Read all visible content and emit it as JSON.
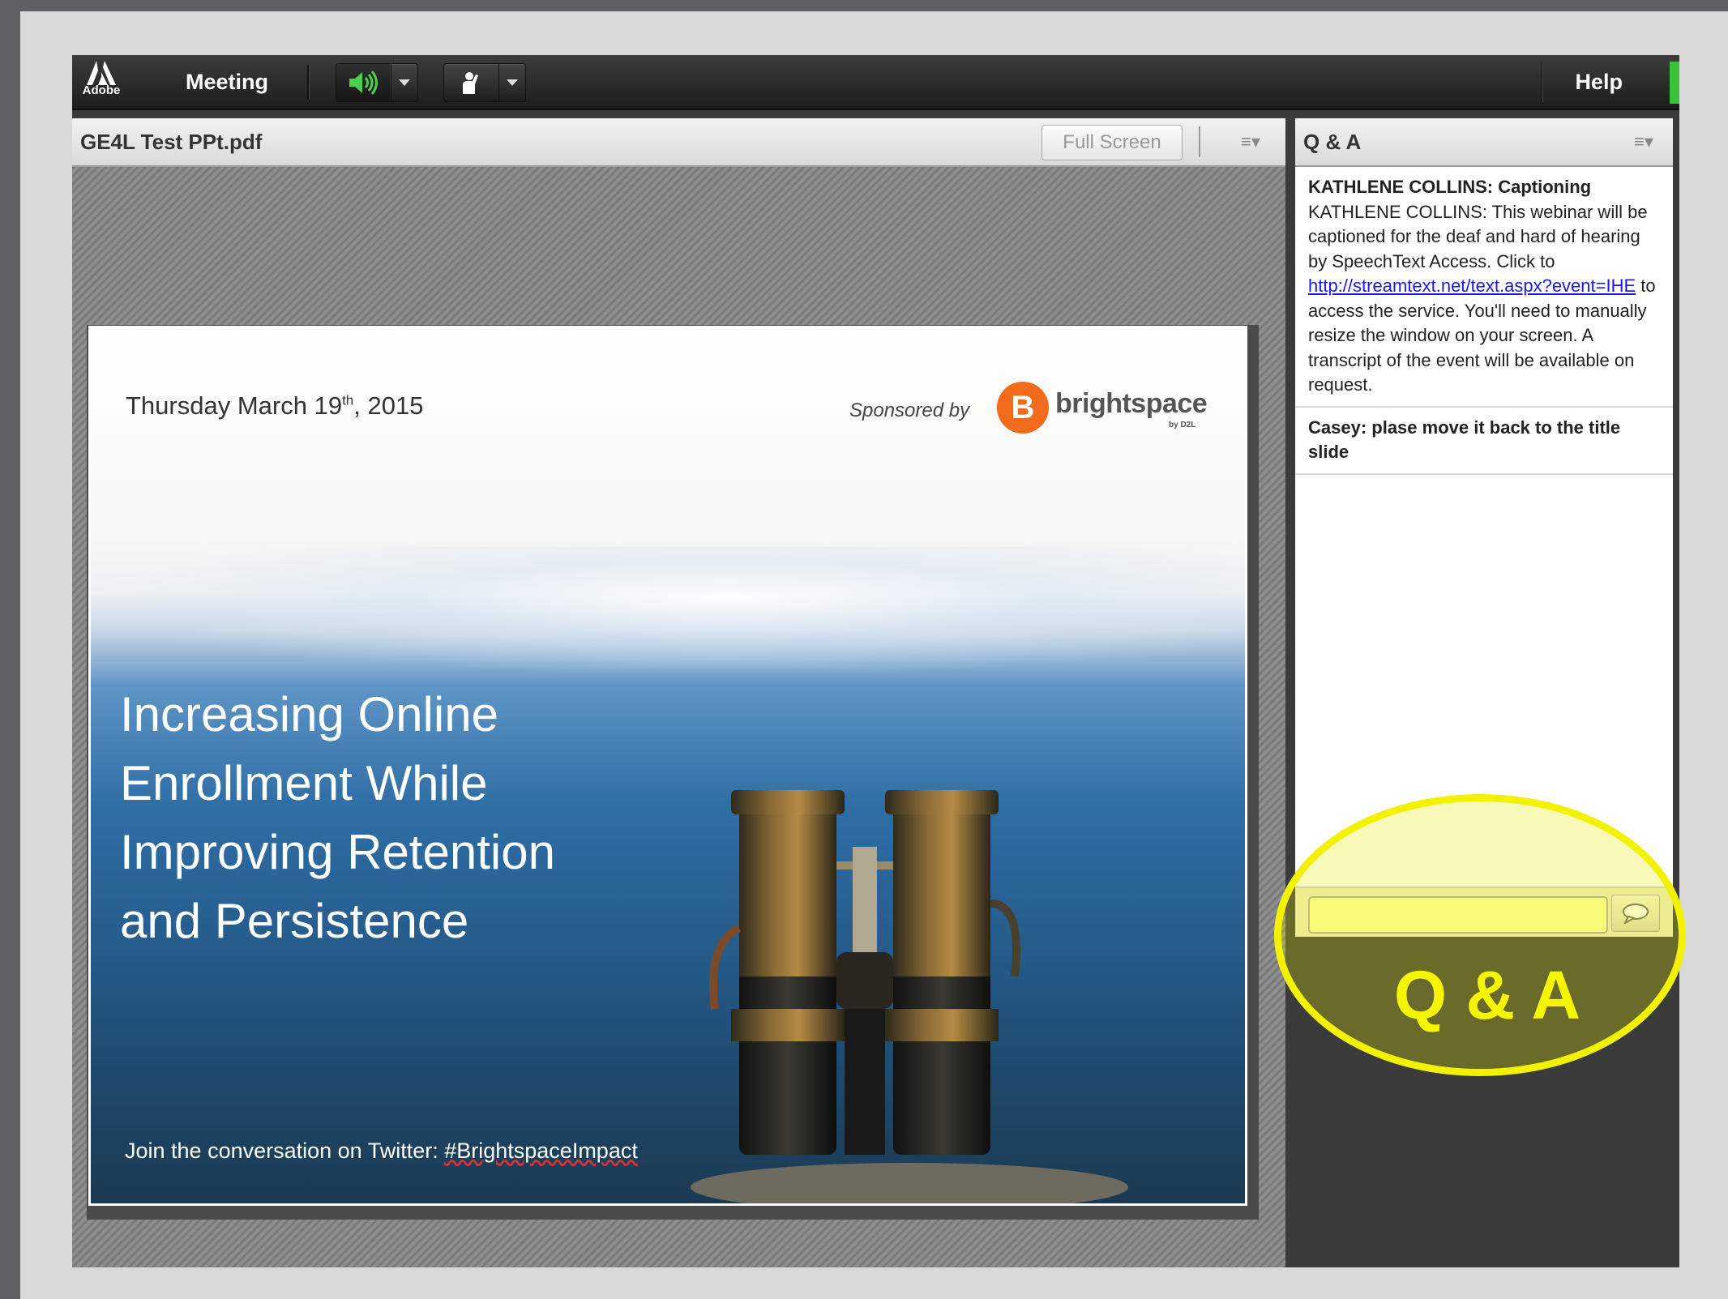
{
  "menubar": {
    "logo_text": "Adobe",
    "meeting_label": "Meeting",
    "audio_icon": "speaker-icon",
    "raise_hand_icon": "raise-hand-icon",
    "help_label": "Help"
  },
  "share_pod": {
    "title": "GE4L Test PPt.pdf",
    "fullscreen_label": "Full Screen",
    "menu_icon": "pod-options-icon"
  },
  "slide": {
    "date_main": "Thursday March 19",
    "date_sup": "th",
    "date_year": ", 2015",
    "sponsored_by": "Sponsored by",
    "brand_initial": "B",
    "brand_name": "brightspace",
    "brand_sub": "by D2L",
    "headline_lines": [
      "Increasing Online",
      "Enrollment While",
      "Improving Retention",
      "and Persistence"
    ],
    "twitter_prefix": "Join the conversation on Twitter: ",
    "twitter_tag": "#BrightspaceImpact"
  },
  "qa_pod": {
    "title": "Q & A",
    "messages": [
      {
        "who": "KATHLENE COLLINS: Captioning",
        "body_before": "KATHLENE COLLINS: This webinar will be captioned for the deaf and hard of hearing by SpeechText Access. Click to ",
        "link": "http://streamtext.net/text.aspx?event=IHE",
        "body_after": " to access the service. You'll need to manually resize the window on your screen. A transcript of the event will be available on request."
      },
      {
        "who": "Casey: plase move it back to the title slide"
      }
    ],
    "input_value": "",
    "send_icon": "speech-bubble-icon"
  },
  "annotation": {
    "label": "Q & A",
    "color": "#f2f200"
  },
  "colors": {
    "brand_orange": "#f26b1d",
    "audio_green": "#39c13a",
    "link_blue": "#1a1aee"
  }
}
